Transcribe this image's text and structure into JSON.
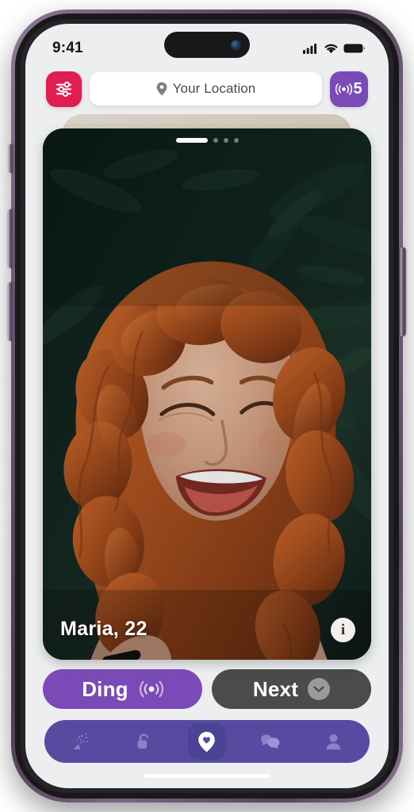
{
  "status_bar": {
    "time": "9:41",
    "signal_icon": "cellular-signal-icon",
    "wifi_icon": "wifi-icon",
    "battery_icon": "battery-full-icon"
  },
  "top_bar": {
    "filter_button": {
      "icon": "sliders-filter-icon",
      "label": ""
    },
    "location_field": {
      "icon": "map-pin-icon",
      "value": "Your Location",
      "placeholder": "Your Location"
    },
    "ding_badge": {
      "icon": "broadcast-signal-icon",
      "count": "5"
    }
  },
  "card": {
    "pagination": {
      "total": 4,
      "active_index": 0
    },
    "profile_name_age": "Maria, 22",
    "info_button_glyph": "i",
    "photo_alt": "smiling woman with curly auburn hair in front of dark green foliage"
  },
  "actions": {
    "ding": {
      "label": "Ding",
      "icon": "broadcast-signal-icon"
    },
    "next": {
      "label": "Next",
      "icon": "chevron-down-icon"
    }
  },
  "bottom_nav": {
    "items": [
      {
        "name": "confetti",
        "icon": "confetti-icon",
        "active": false
      },
      {
        "name": "unlock",
        "icon": "unlock-padlock-icon",
        "active": false
      },
      {
        "name": "discover",
        "icon": "map-pin-heart-icon",
        "active": true
      },
      {
        "name": "chats",
        "icon": "chat-bubbles-icon",
        "active": false
      },
      {
        "name": "profile",
        "icon": "person-icon",
        "active": false
      }
    ]
  },
  "colors": {
    "accent_pink": "#e01e50",
    "accent_purple": "#7a4bb6",
    "nav_purple": "#564ba0",
    "nav_active_purple": "#4d4394",
    "next_gray": "#4b4b4b",
    "screen_bg": "#eceef0"
  }
}
